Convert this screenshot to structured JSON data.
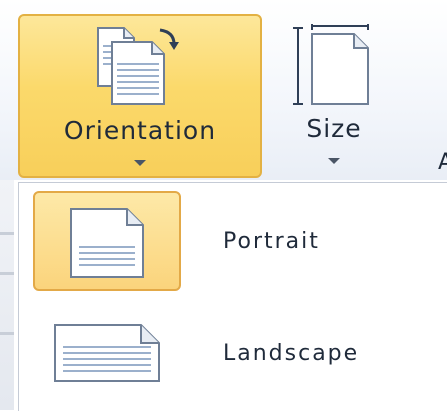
{
  "ribbon": {
    "orientation_button": {
      "label": "Orientation",
      "icon": "orientation-icon",
      "state": "pressed"
    },
    "size_button": {
      "label": "Size",
      "icon": "page-size-icon"
    },
    "cut_off_glyph": "A"
  },
  "orientation_menu": {
    "items": [
      {
        "label": "Portrait",
        "icon": "portrait-page-icon",
        "selected": true
      },
      {
        "label": "Landscape",
        "icon": "landscape-page-icon",
        "selected": false
      }
    ]
  },
  "colors": {
    "highlight_fill": "#fbd96b",
    "highlight_border": "#e3b143",
    "page_line": "#9bb0cc",
    "text": "#1f2a3a"
  }
}
